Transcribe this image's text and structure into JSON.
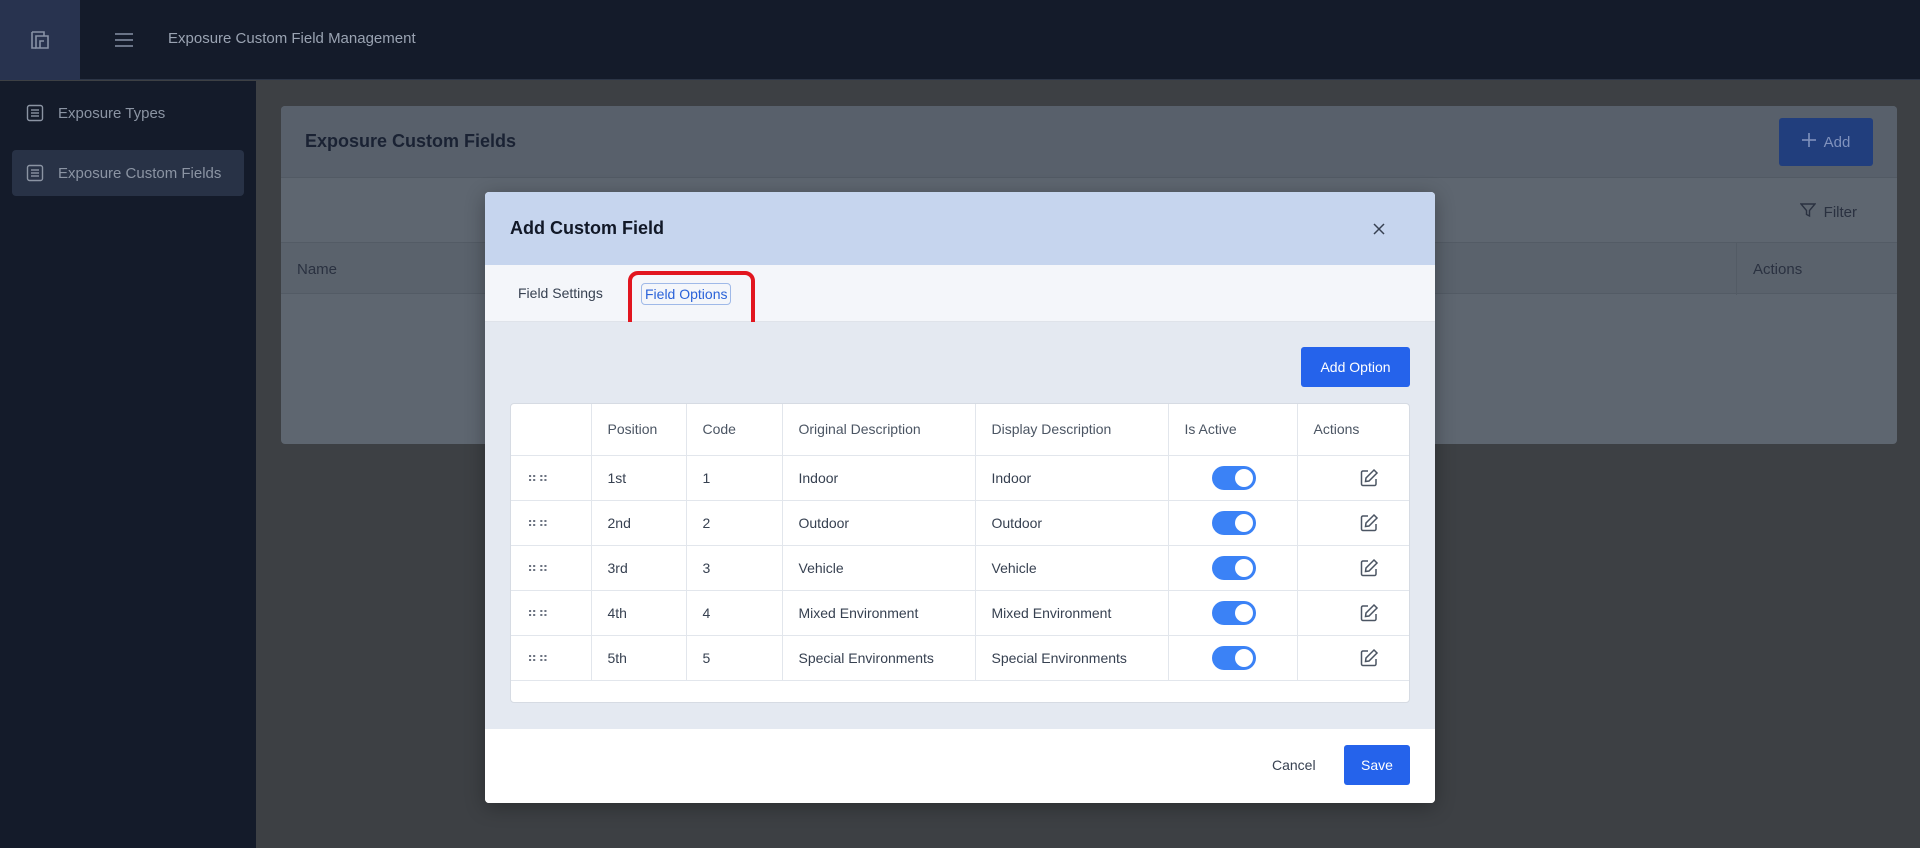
{
  "header": {
    "app_title": "Exposure Custom Field Management",
    "logo_icon": "app-logo-icon",
    "menu_icon": "hamburger-icon"
  },
  "sidebar": {
    "items": [
      {
        "label": "Exposure Types",
        "icon": "list-icon",
        "active": false
      },
      {
        "label": "Exposure Custom Fields",
        "icon": "list-icon",
        "active": true
      }
    ]
  },
  "page": {
    "title": "Exposure Custom Fields",
    "add_label": "Add",
    "filter_label": "Filter",
    "columns": {
      "name": "Name",
      "actions": "Actions"
    }
  },
  "modal": {
    "title": "Add Custom Field",
    "tabs": [
      {
        "label": "Field Settings",
        "active": false
      },
      {
        "label": "Field Options",
        "active": true
      }
    ],
    "add_option_label": "Add Option",
    "table": {
      "headers": [
        "",
        "Position",
        "Code",
        "Original Description",
        "Display Description",
        "Is Active",
        "Actions"
      ],
      "rows": [
        {
          "position": "1st",
          "code": "1",
          "original": "Indoor",
          "display": "Indoor",
          "active": true
        },
        {
          "position": "2nd",
          "code": "2",
          "original": "Outdoor",
          "display": "Outdoor",
          "active": true
        },
        {
          "position": "3rd",
          "code": "3",
          "original": "Vehicle",
          "display": "Vehicle",
          "active": true
        },
        {
          "position": "4th",
          "code": "4",
          "original": "Mixed Environment",
          "display": "Mixed Environment",
          "active": true
        },
        {
          "position": "5th",
          "code": "5",
          "original": "Special Environments",
          "display": "Special Environments",
          "active": true
        }
      ]
    },
    "cancel_label": "Cancel",
    "save_label": "Save"
  },
  "colors": {
    "accent": "#2563eb",
    "toggle_on": "#3b82f6",
    "highlight": "#e2161f",
    "modal_header": "#c6d5ee"
  }
}
